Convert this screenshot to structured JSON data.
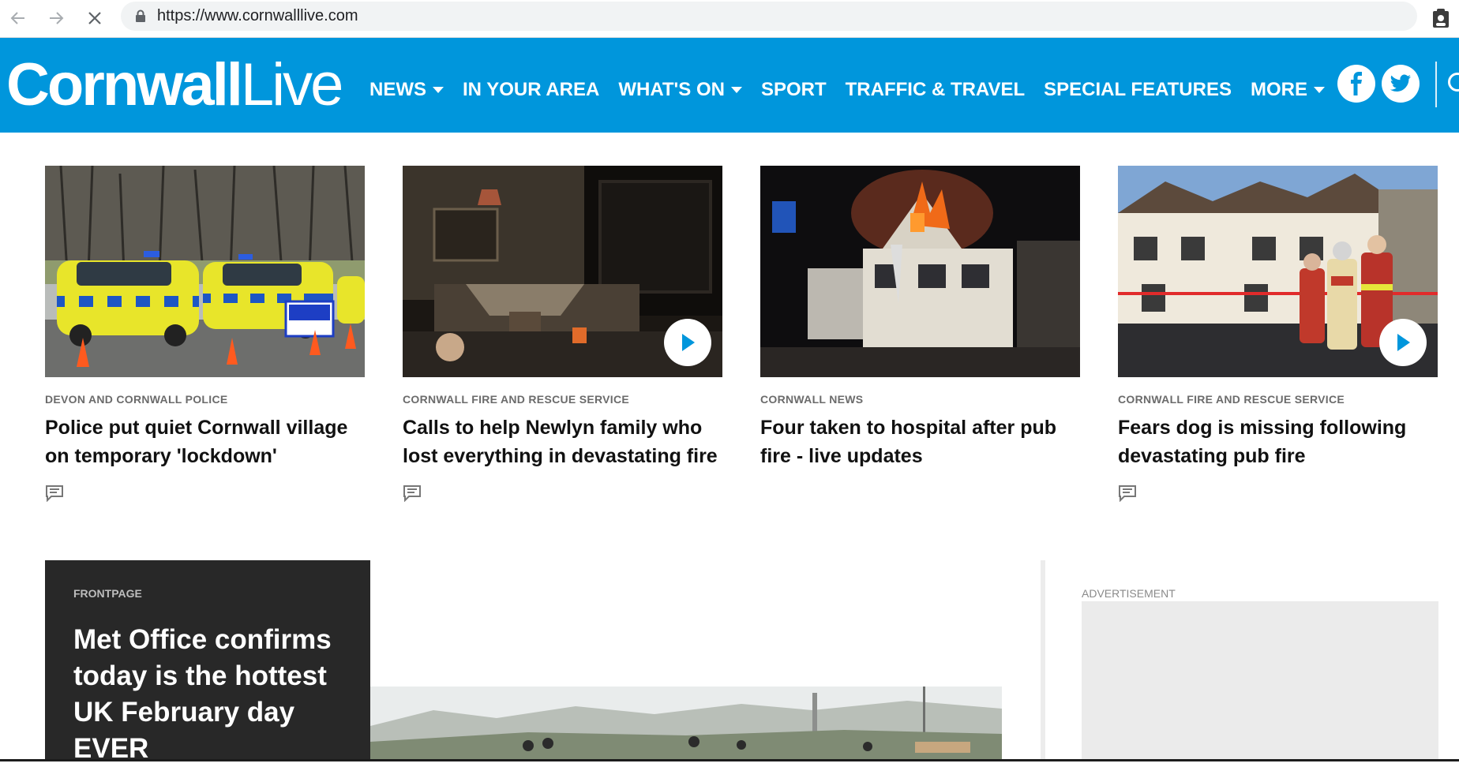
{
  "browser": {
    "url": "https://www.cornwalllive.com"
  },
  "header": {
    "logo_bold": "Cornwall",
    "logo_light": "Live",
    "brand_color": "#0096dc",
    "nav": [
      {
        "label": "NEWS",
        "dropdown": true
      },
      {
        "label": "IN YOUR AREA",
        "dropdown": false
      },
      {
        "label": "WHAT'S ON",
        "dropdown": true
      },
      {
        "label": "SPORT",
        "dropdown": false
      },
      {
        "label": "TRAFFIC & TRAVEL",
        "dropdown": false
      },
      {
        "label": "SPECIAL FEATURES",
        "dropdown": false
      },
      {
        "label": "MORE",
        "dropdown": true
      }
    ],
    "social": [
      {
        "icon": "facebook-icon"
      },
      {
        "icon": "twitter-icon"
      }
    ]
  },
  "cards": [
    {
      "category": "DEVON AND CORNWALL POLICE",
      "headline": "Police put quiet Cornwall village on temporary 'lockdown'",
      "video": false
    },
    {
      "category": "CORNWALL FIRE AND RESCUE SERVICE",
      "headline": "Calls to help Newlyn family who lost everything in devastating fire",
      "video": true
    },
    {
      "category": "CORNWALL NEWS",
      "headline": "Four taken to hospital after pub fire - live updates",
      "video": false
    },
    {
      "category": "CORNWALL FIRE AND RESCUE SERVICE",
      "headline": "Fears dog is missing following devastating pub fire",
      "video": true
    }
  ],
  "frontpage": {
    "category": "FRONTPAGE",
    "headline": "Met Office confirms today is the hottest UK February day EVER"
  },
  "ad": {
    "label": "ADVERTISEMENT"
  }
}
